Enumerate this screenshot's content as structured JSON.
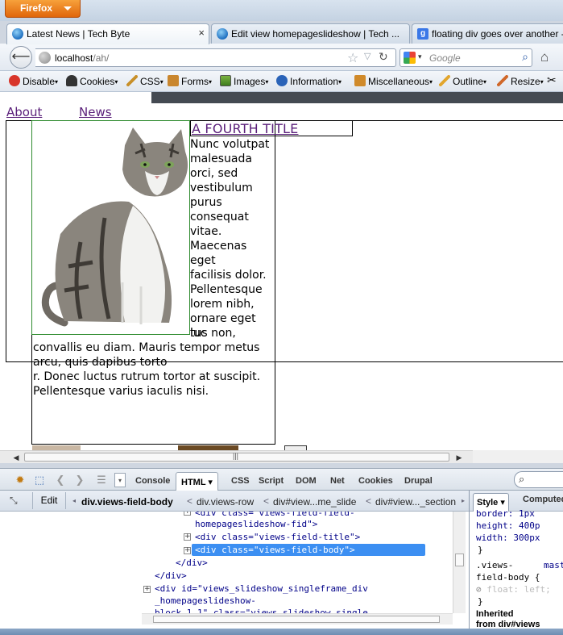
{
  "window": {
    "firefox_label": "Firefox",
    "colors": {
      "firefox_orange": "#e0660b",
      "link_purple": "#5a1f7a",
      "selection_blue": "#3c8ff2"
    }
  },
  "tabs": [
    {
      "label": "Latest News | Tech Byte",
      "close": "×"
    },
    {
      "label": "Edit view homepageslideshow | Tech ..."
    },
    {
      "label": "floating div goes over another -"
    }
  ],
  "nav": {
    "url_host": "localhost",
    "url_path": "/ah/",
    "search_placeholder": "Google"
  },
  "devbar": {
    "items": [
      "Disable",
      "Cookies",
      "CSS",
      "Forms",
      "Images",
      "Information",
      "Miscellaneous",
      "Outline",
      "Resize"
    ]
  },
  "page": {
    "menu": [
      "About",
      "News"
    ],
    "slide_title": "A FOURTH TITLE",
    "body_narrow_lines": [
      "Nunc volutpat",
      "malesuada",
      "orci, sed",
      "vestibulum",
      "purus",
      "consequat",
      "vitae.",
      "Maecenas eget",
      "facilisis dolor.",
      "Pellentesque",
      "lorem nibh,",
      "ornare eget",
      "luc"
    ],
    "body_wide_lines": [
      "tus non,",
      "convallis eu diam. Mauris tempor metus",
      "arcu, quis dapibus torto",
      "r. Donec luctus rutrum tortor at suscipit.",
      "Pellentesque varius iaculis nisi."
    ]
  },
  "firebug": {
    "tabs": [
      "Console",
      "HTML",
      "CSS",
      "Script",
      "DOM",
      "Net",
      "Cookies",
      "Drupal"
    ],
    "active_tab": "HTML",
    "crumbs": {
      "edit": "Edit",
      "items": [
        "div.views-field-body",
        "div.views-row",
        "div#view...me_slide",
        "div#view..._section"
      ]
    },
    "html_lines": [
      {
        "text": "<div class=\"views-field-field-",
        "indent": 1
      },
      {
        "text": "homepageslideshow-fid\">",
        "indent": 2
      },
      {
        "text": "<div class=\"views-field-title\">",
        "indent": 1
      },
      {
        "text": "<div class=\"views-field-body\">",
        "indent": 1
      },
      {
        "text": "</div>",
        "indent": 0
      },
      {
        "text": "</div>",
        "indent": -1
      },
      {
        "text": "<div id=\"views_slideshow_singleframe_div",
        "indent": -2
      },
      {
        "text": "_homepageslideshow-",
        "indent": -1
      },
      {
        "text": "block_1_1\" class=\"views_slideshow_single",
        "indent": -1
      }
    ],
    "side": {
      "tabs": [
        "Style",
        "Computed"
      ],
      "css_lines": [
        "border: 1px",
        "height: 400p",
        "width: 300px",
        "}",
        ".views-",
        "field-body {",
        "float: left;",
        "}",
        "Inherited",
        "from div#views"
      ],
      "mast_label": "mast"
    }
  }
}
